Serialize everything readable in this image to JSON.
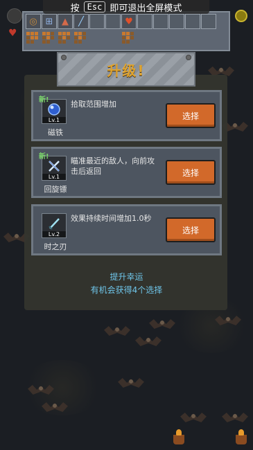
{
  "banner": {
    "prefix": "按",
    "key": "Esc",
    "suffix": "即可退出全屏模式"
  },
  "inventory": {
    "weapons": [
      "whip",
      "shield",
      "potion",
      "sword",
      "",
      "",
      "",
      ""
    ],
    "passives": [
      "heart",
      "",
      "",
      "",
      "",
      "",
      "",
      ""
    ]
  },
  "levelup": {
    "title": "升级!",
    "options": [
      {
        "is_new": true,
        "new_label": "新!",
        "level": "Lv.1",
        "name": "磁铁",
        "description": "拾取范围增加",
        "button": "选择",
        "icon": "blue-orb-icon"
      },
      {
        "is_new": true,
        "new_label": "新!",
        "level": "Lv.1",
        "name": "回旋镖",
        "description": "瞄准最近的敌人，向前攻击后返回",
        "button": "选择",
        "icon": "cross-blades-icon"
      },
      {
        "is_new": false,
        "new_label": "",
        "level": "Lv.2",
        "name": "时之刃",
        "description": "效果持续时间增加1.0秒",
        "button": "选择",
        "icon": "time-blade-icon"
      }
    ],
    "luck_title": "提升幸运",
    "luck_desc": "有机会获得4个选择"
  },
  "colors": {
    "button": "#d2692a",
    "title": "#e0a430",
    "luck_text": "#6fc6ea",
    "new_text": "#7bd46b"
  }
}
